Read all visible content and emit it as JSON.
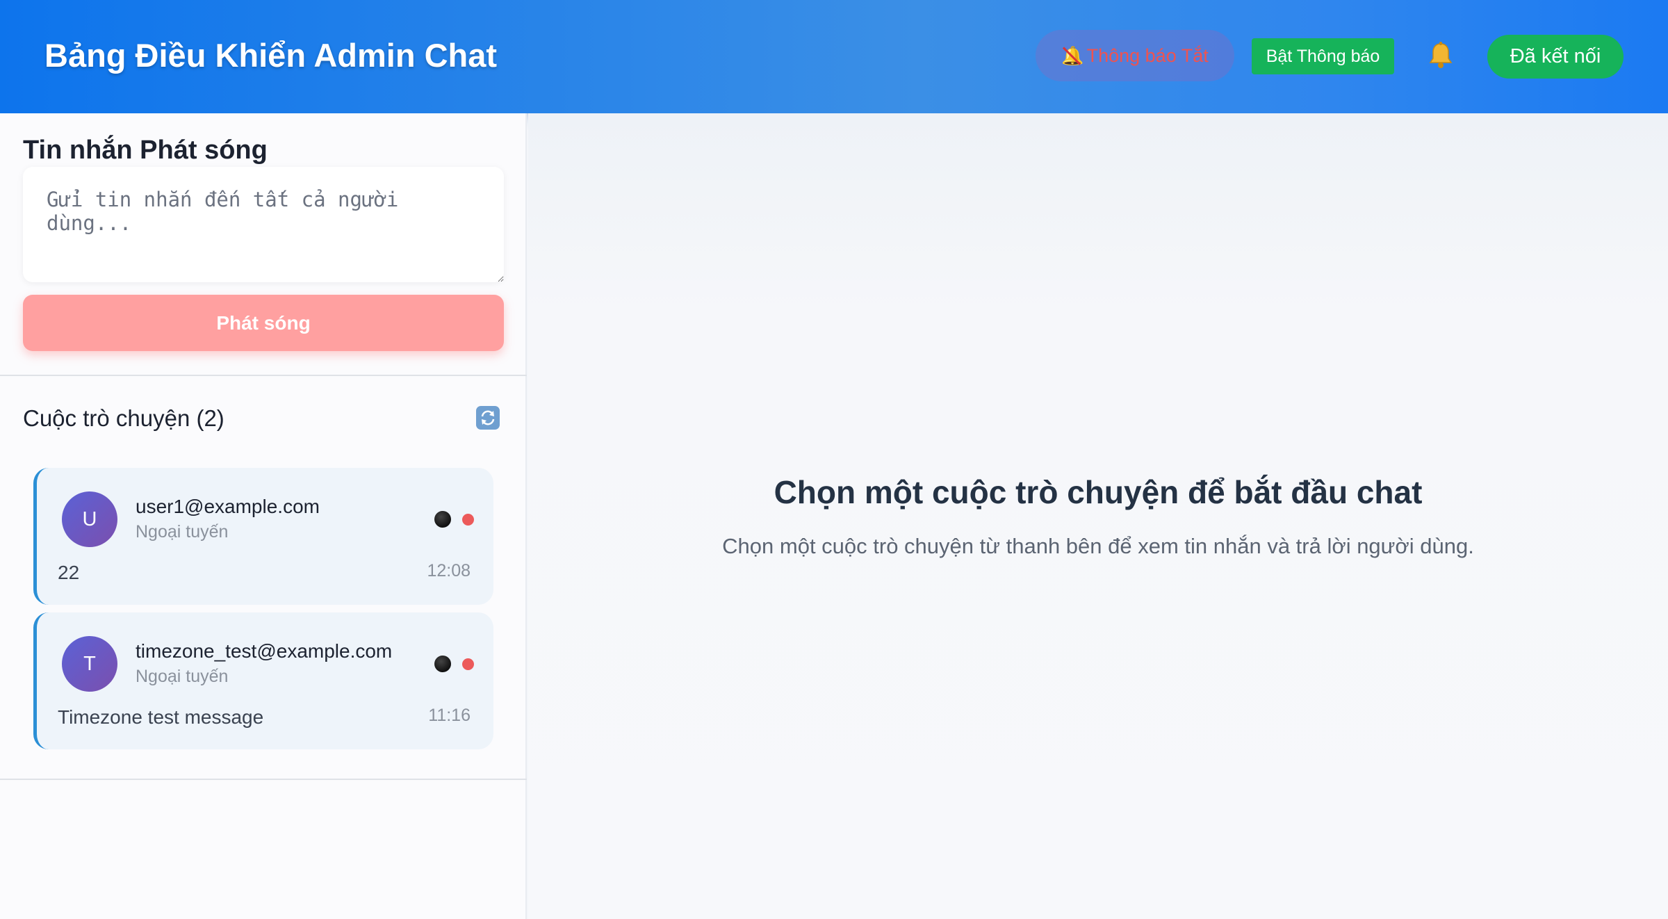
{
  "header": {
    "title": "Bảng Điều Khiển Admin Chat",
    "notifications_off_label": "Thông báo Tắt",
    "notifications_on_label": "Bật Thông báo",
    "connection_status": "Đã kết nối",
    "bell_icon": "bell-icon",
    "colors": {
      "header_blue": "#1b7af2",
      "success_green": "#16b35a"
    }
  },
  "sidebar": {
    "broadcast": {
      "title": "Tin nhắn Phát sóng",
      "placeholder": "Gửi tin nhắn đến tất cả người dùng...",
      "button_label": "Phát sóng",
      "button_color": "#ffa0a0"
    },
    "conversations": {
      "heading": "Cuộc trò chuyện (2)",
      "refresh_icon": "refresh-icon",
      "items": [
        {
          "avatar_letter": "U",
          "email": "user1@example.com",
          "status": "Ngoại tuyến",
          "last_message": "22",
          "time": "12:08"
        },
        {
          "avatar_letter": "T",
          "email": "timezone_test@example.com",
          "status": "Ngoại tuyến",
          "last_message": "Timezone test message",
          "time": "11:16"
        }
      ]
    }
  },
  "main": {
    "empty_title": "Chọn một cuộc trò chuyện để bắt đầu chat",
    "empty_subtitle": "Chọn một cuộc trò chuyện từ thanh bên để xem tin nhắn và trả lời người dùng."
  }
}
